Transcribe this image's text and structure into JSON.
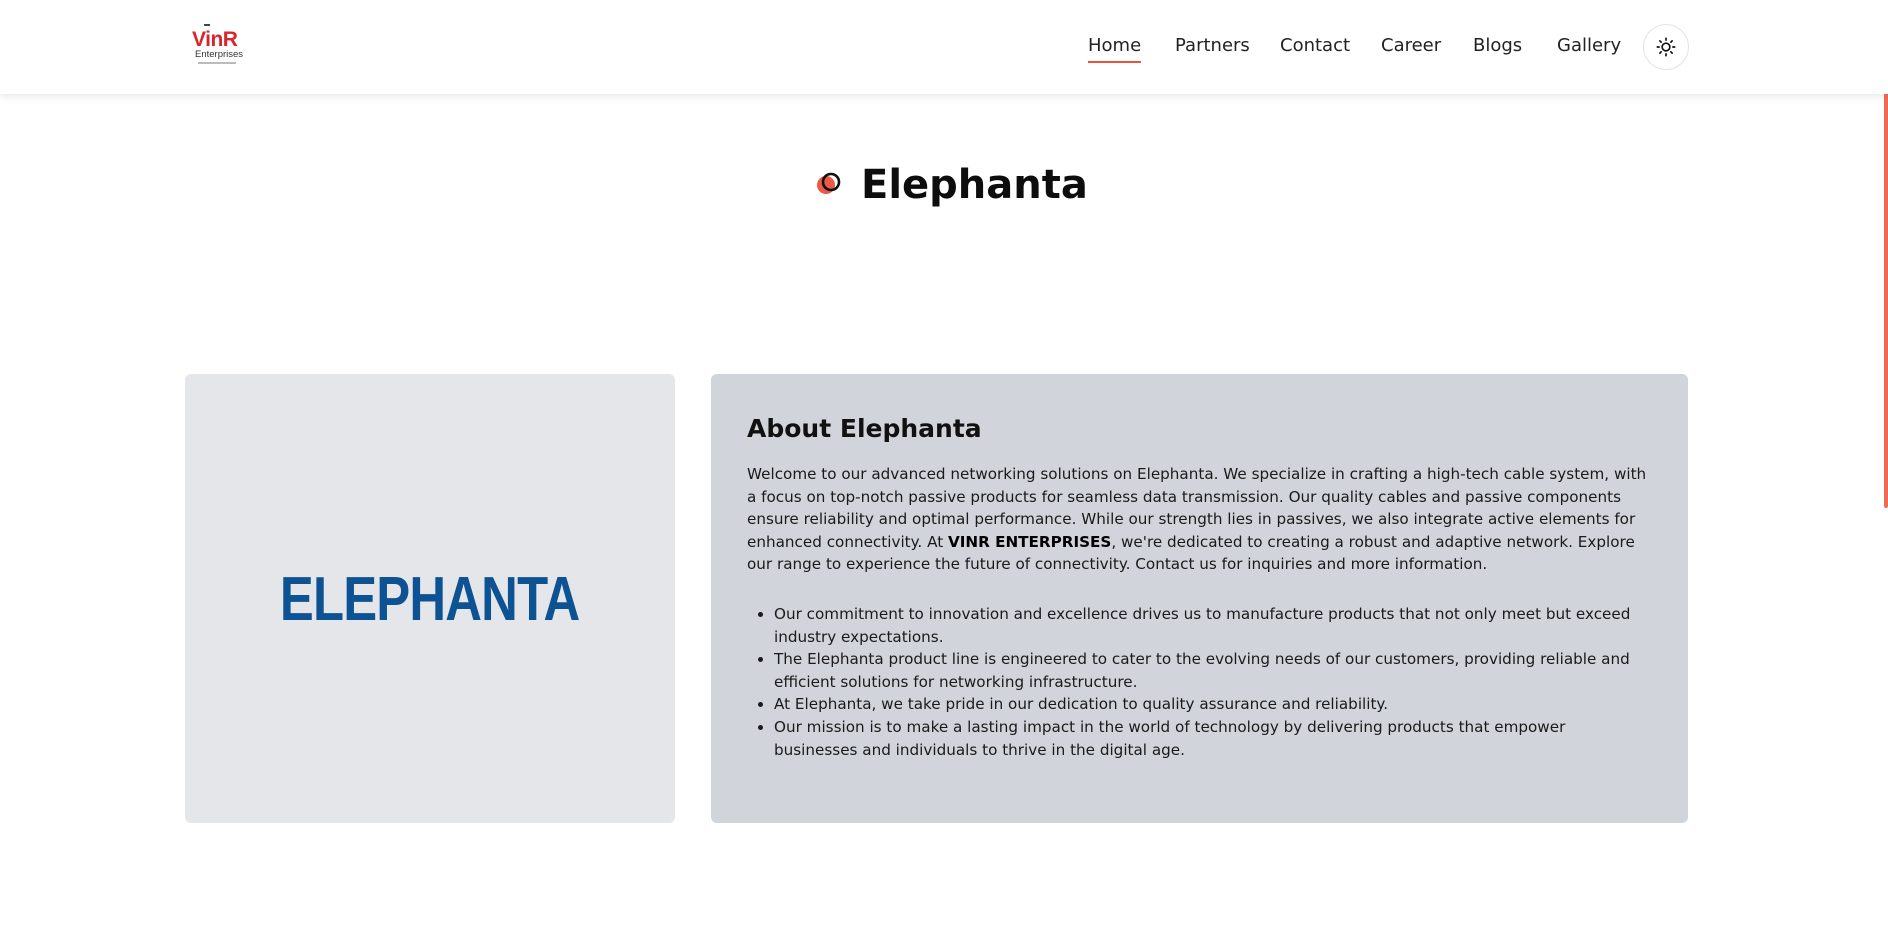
{
  "header": {
    "logo": {
      "main": "VinR",
      "sub": "Enterprises"
    },
    "nav": [
      {
        "label": "Home",
        "active": true
      },
      {
        "label": "Partners",
        "active": false
      },
      {
        "label": "Contact",
        "active": false
      },
      {
        "label": "Career",
        "active": false
      },
      {
        "label": "Blogs",
        "active": false
      },
      {
        "label": "Gallery",
        "active": false
      }
    ],
    "theme_toggle_icon": "sun-icon"
  },
  "page": {
    "title": "Elephanta",
    "title_icon": "circles-icon"
  },
  "brand_card": {
    "logo_text": "ELEPHANTA",
    "logo_color": "#0d5394"
  },
  "about": {
    "title": "About Elephanta",
    "para_part1": "Welcome to our advanced networking solutions on Elephanta. We specialize in crafting a high-tech cable system, with a focus on top-notch passive products for seamless data transmission. Our quality cables and passive components ensure reliability and optimal performance. While our strength lies in passives, we also integrate active elements for enhanced connectivity. At ",
    "para_bold": "VINR ENTERPRISES",
    "para_part2": ", we're dedicated to creating a robust and adaptive network. Explore our range to experience the future of connectivity. Contact us for inquiries and more information.",
    "bullets": [
      "Our commitment to innovation and excellence drives us to manufacture products that not only meet but exceed industry expectations.",
      "The Elephanta product line is engineered to cater to the evolving needs of our customers, providing reliable and efficient solutions for networking infrastructure.",
      "At Elephanta, we take pride in our dedication to quality assurance and reliability.",
      "Our mission is to make a lasting impact in the world of technology by delivering products that empower businesses and individuals to thrive in the digital age."
    ]
  },
  "colors": {
    "accent": "#e8553d",
    "brand_blue": "#0d5394",
    "card_light": "#e4e6ea",
    "card_dark": "#d1d4db"
  }
}
